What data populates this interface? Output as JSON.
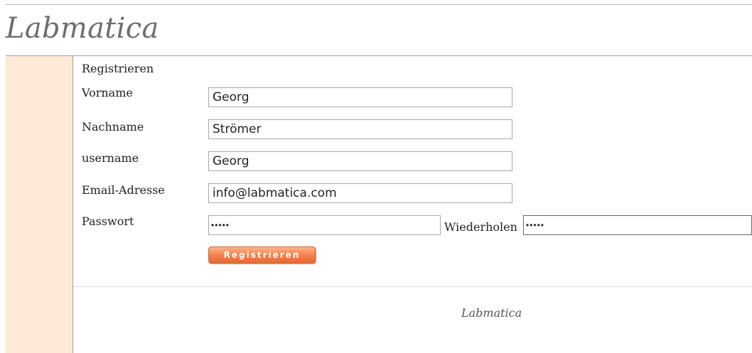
{
  "header": {
    "logo_text": "Labmatica"
  },
  "form": {
    "title": "Registrieren",
    "fields": [
      {
        "label": "Vorname",
        "value": "Georg"
      },
      {
        "label": "Nachname",
        "value": "Strömer"
      },
      {
        "label": "username",
        "value": "Georg"
      },
      {
        "label": "Email-Adresse",
        "value": "info@labmatica.com"
      }
    ],
    "password": {
      "label": "Passwort",
      "value": "•••••"
    },
    "repeat": {
      "label": "Wiederholen",
      "value": "•••••"
    },
    "submit_label": "Registrieren"
  },
  "footer": {
    "text": "Labmatica"
  },
  "colors": {
    "sidebar": "#fde9d5",
    "button": "#f37e4a"
  }
}
